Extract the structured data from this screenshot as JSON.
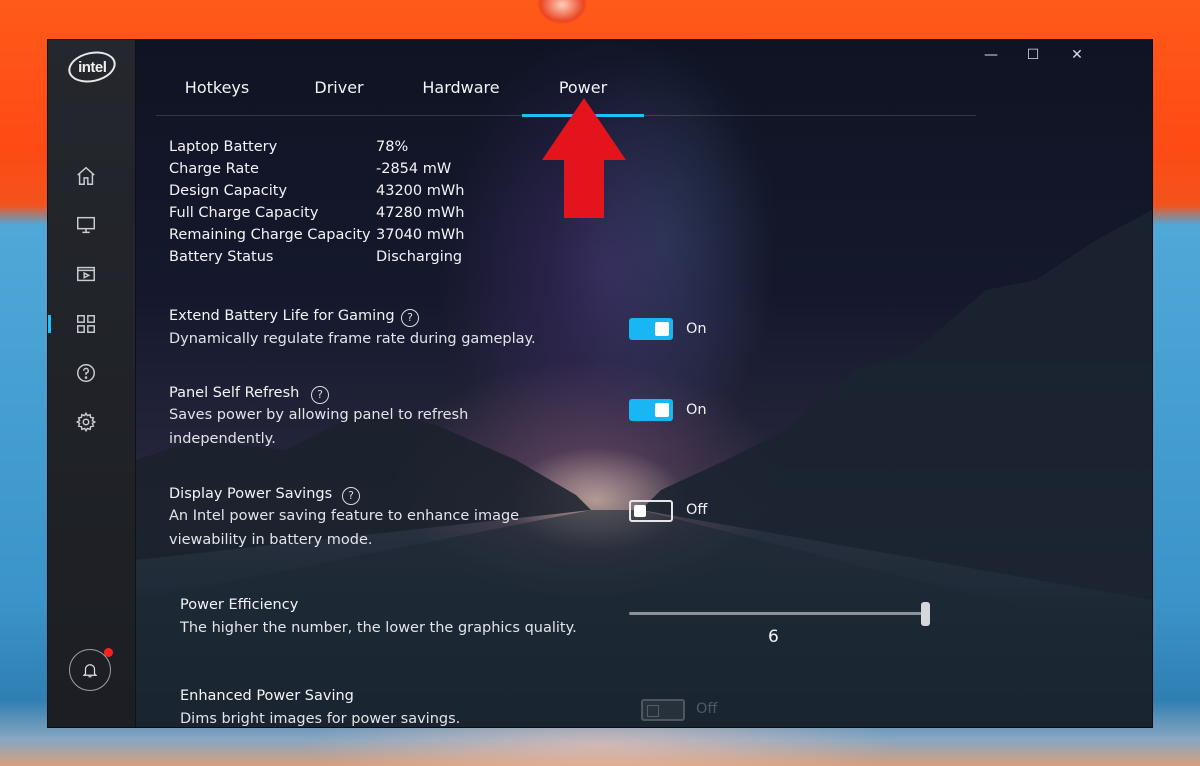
{
  "sidebar": {
    "logo_text": "intel",
    "items": [
      {
        "icon": "home-icon"
      },
      {
        "icon": "display-icon"
      },
      {
        "icon": "video-icon"
      },
      {
        "icon": "apps-grid-icon"
      },
      {
        "icon": "help-icon"
      },
      {
        "icon": "gear-icon"
      }
    ],
    "active_index": 3,
    "notification_icon": "bell-icon"
  },
  "window_controls": {
    "minimize": "—",
    "maximize": "☐",
    "close": "✕"
  },
  "tabs": [
    {
      "label": "Hotkeys"
    },
    {
      "label": "Driver"
    },
    {
      "label": "Hardware"
    },
    {
      "label": "Power"
    }
  ],
  "active_tab": "Power",
  "battery_info": [
    {
      "label": "Laptop Battery",
      "value": "78%"
    },
    {
      "label": "Charge Rate",
      "value": "-2854 mW"
    },
    {
      "label": "Design Capacity",
      "value": "43200 mWh"
    },
    {
      "label": "Full Charge Capacity",
      "value": "47280 mWh"
    },
    {
      "label": "Remaining Charge Capacity",
      "value": "37040 mWh"
    },
    {
      "label": "Battery Status",
      "value": "Discharging"
    }
  ],
  "settings": {
    "extend_battery": {
      "title": "Extend Battery Life for Gaming",
      "desc": "Dynamically regulate frame rate during gameplay.",
      "state": "On"
    },
    "panel_self_refresh": {
      "title": "Panel Self Refresh",
      "desc1": "Saves power by allowing panel to refresh",
      "desc2": "independently.",
      "state": "On"
    },
    "display_power_savings": {
      "title": "Display Power Savings",
      "desc1": "An Intel power saving feature to enhance image",
      "desc2": "viewability in battery mode.",
      "state": "Off"
    },
    "power_efficiency": {
      "title": "Power Efficiency",
      "desc": "The higher the number, the lower the graphics quality.",
      "value": "6"
    },
    "enhanced_power_saving": {
      "title": "Enhanced Power Saving",
      "desc": "Dims bright images for power savings.",
      "state": "Off"
    }
  },
  "colors": {
    "accent": "#1ec0f5",
    "arrow": "#e3141b",
    "notification": "#ff2020"
  }
}
